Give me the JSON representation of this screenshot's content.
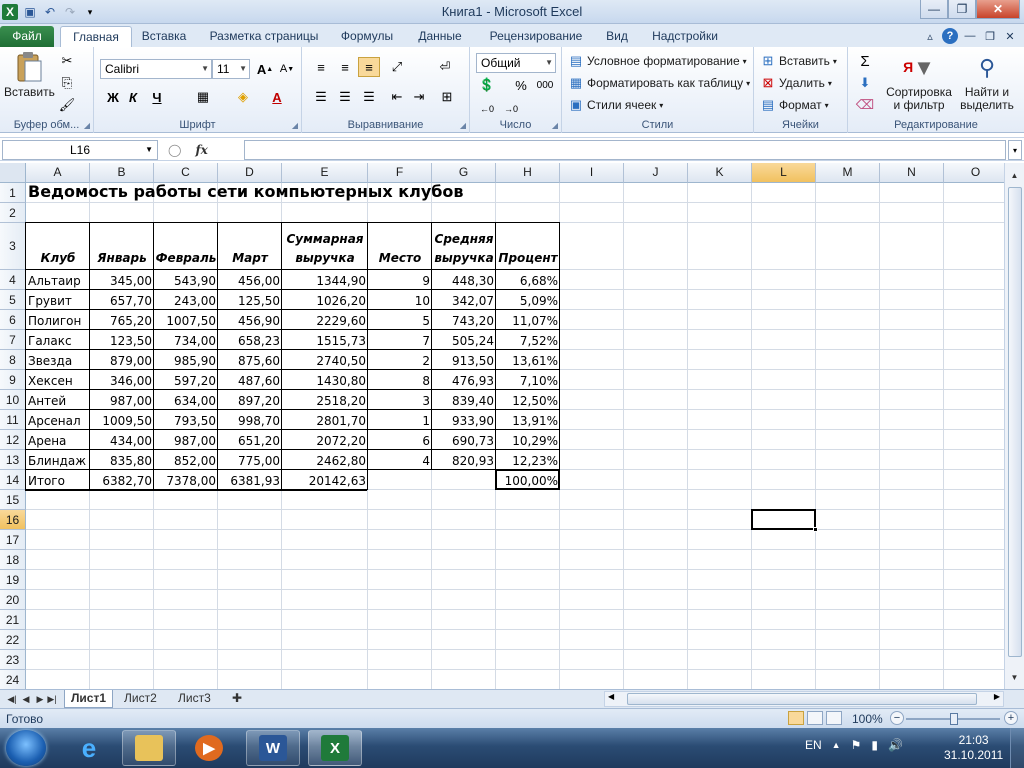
{
  "window": {
    "title": "Книга1 - Microsoft Excel",
    "controls": [
      "—",
      "❐",
      "✕"
    ]
  },
  "ribbon": {
    "tabs": [
      "Файл",
      "Главная",
      "Вставка",
      "Разметка страницы",
      "Формулы",
      "Данные",
      "Рецензирование",
      "Вид",
      "Надстройки"
    ],
    "active_tab": "Главная",
    "clipboard": {
      "paste": "Вставить",
      "label": "Буфер обм..."
    },
    "font": {
      "name": "Calibri",
      "size": "11",
      "bold": "Ж",
      "italic": "К",
      "underline": "Ч",
      "label": "Шрифт"
    },
    "alignment": {
      "label": "Выравнивание"
    },
    "number": {
      "format": "Общий",
      "percent": "%",
      "thousands": "000",
      "label": "Число"
    },
    "styles": {
      "conditional": "Условное форматирование",
      "as_table": "Форматировать как таблицу",
      "cell_styles": "Стили ячеек",
      "label": "Стили"
    },
    "cells": {
      "insert": "Вставить",
      "delete": "Удалить",
      "format": "Формат",
      "label": "Ячейки"
    },
    "editing": {
      "sigma": "Σ",
      "sort_line1": "Сортировка",
      "sort_line2": "и фильтр",
      "find_line1": "Найти и",
      "find_line2": "выделить",
      "label": "Редактирование"
    }
  },
  "formula_bar": {
    "name_box": "L16",
    "fx": "fx",
    "content": ""
  },
  "sheet": {
    "columns": [
      "A",
      "B",
      "C",
      "D",
      "E",
      "F",
      "G",
      "H",
      "I",
      "J",
      "K",
      "L",
      "M",
      "N",
      "O"
    ],
    "rows": [
      "1",
      "2",
      "3",
      "4",
      "5",
      "6",
      "7",
      "8",
      "9",
      "10",
      "11",
      "12",
      "13",
      "14",
      "15",
      "16",
      "17",
      "18",
      "19",
      "20",
      "21",
      "22",
      "23",
      "24"
    ],
    "selected_cell": "L16",
    "title": "Ведомость работы сети компьютерных клубов",
    "headers": {
      "club": "Клуб",
      "jan": "Январь",
      "feb": "Февраль",
      "mar": "Март",
      "total_l1": "Суммарная",
      "total_l2": "выручка",
      "place": "Место",
      "avg_l1": "Средняя",
      "avg_l2": "выручка",
      "percent": "Процент"
    },
    "table": [
      {
        "club": "Альтаир",
        "jan": "345,00",
        "feb": "543,90",
        "mar": "456,00",
        "total": "1344,90",
        "place": "9",
        "avg": "448,30",
        "pct": "6,68%"
      },
      {
        "club": "Грувит",
        "jan": "657,70",
        "feb": "243,00",
        "mar": "125,50",
        "total": "1026,20",
        "place": "10",
        "avg": "342,07",
        "pct": "5,09%"
      },
      {
        "club": "Полигон",
        "jan": "765,20",
        "feb": "1007,50",
        "mar": "456,90",
        "total": "2229,60",
        "place": "5",
        "avg": "743,20",
        "pct": "11,07%"
      },
      {
        "club": "Галакс",
        "jan": "123,50",
        "feb": "734,00",
        "mar": "658,23",
        "total": "1515,73",
        "place": "7",
        "avg": "505,24",
        "pct": "7,52%"
      },
      {
        "club": "Звезда",
        "jan": "879,00",
        "feb": "985,90",
        "mar": "875,60",
        "total": "2740,50",
        "place": "2",
        "avg": "913,50",
        "pct": "13,61%"
      },
      {
        "club": "Хексен",
        "jan": "346,00",
        "feb": "597,20",
        "mar": "487,60",
        "total": "1430,80",
        "place": "8",
        "avg": "476,93",
        "pct": "7,10%"
      },
      {
        "club": "Антей",
        "jan": "987,00",
        "feb": "634,00",
        "mar": "897,20",
        "total": "2518,20",
        "place": "3",
        "avg": "839,40",
        "pct": "12,50%"
      },
      {
        "club": "Арсенал",
        "jan": "1009,50",
        "feb": "793,50",
        "mar": "998,70",
        "total": "2801,70",
        "place": "1",
        "avg": "933,90",
        "pct": "13,91%"
      },
      {
        "club": "Арена",
        "jan": "434,00",
        "feb": "987,00",
        "mar": "651,20",
        "total": "2072,20",
        "place": "6",
        "avg": "690,73",
        "pct": "10,29%"
      },
      {
        "club": "Блиндаж",
        "jan": "835,80",
        "feb": "852,00",
        "mar": "775,00",
        "total": "2462,80",
        "place": "4",
        "avg": "820,93",
        "pct": "12,23%"
      }
    ],
    "totals": {
      "club": "Итого",
      "jan": "6382,70",
      "feb": "7378,00",
      "mar": "6381,93",
      "total": "20142,63",
      "pct": "100,00%"
    },
    "sheet_tabs": [
      "Лист1",
      "Лист2",
      "Лист3"
    ],
    "active_sheet": "Лист1"
  },
  "status": {
    "ready": "Готово",
    "zoom": "100%"
  },
  "taskbar": {
    "lang": "EN",
    "time": "21:03",
    "date": "31.10.2011"
  }
}
